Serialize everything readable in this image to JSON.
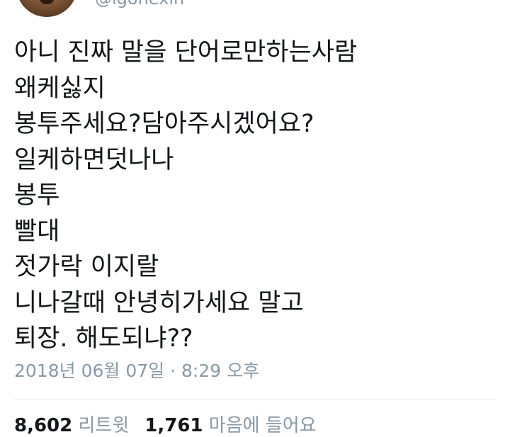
{
  "author": {
    "handle": "@igonexin",
    "avatar_icon": "profile-photo"
  },
  "tweet": {
    "lines": [
      "아니 진짜 말을 단어로만하는사람",
      "왜케싫지",
      "봉투주세요?담아주시겠어요?",
      "일케하면덧나나",
      "봉투",
      "빨대",
      "젓가락 이지랄",
      "니나갈때 안녕히가세요 말고",
      "퇴장.  해도되냐??"
    ],
    "timestamp": "2018년 06월 07일 · 8:29 오후"
  },
  "stats": {
    "retweet_count": "8,602",
    "retweet_label": "리트윗",
    "like_count": "1,761",
    "like_label": "마음에 들어요"
  },
  "colors": {
    "text": "#14171a",
    "secondary": "#8899a6",
    "divider": "#e1e8ed"
  }
}
